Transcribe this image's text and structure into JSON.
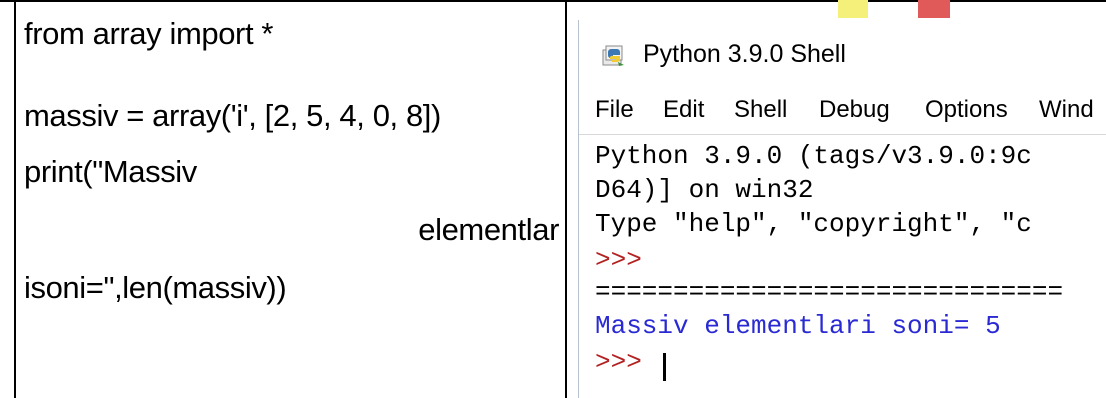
{
  "code_cell": {
    "line1": "from array import *",
    "line2": "massiv = array('i', [2, 5, 4, 0, 8])",
    "line3": "print(\"Massiv",
    "line4": "elementlar",
    "line5": "isoni=\",len(massiv))"
  },
  "shell": {
    "title": "Python 3.9.0 Shell",
    "menu": [
      "File",
      "Edit",
      "Shell",
      "Debug",
      "Options",
      "Wind"
    ],
    "console_lines": [
      "Python 3.9.0 (tags/v3.9.0:9c",
      "D64)] on win32",
      "Type \"help\", \"copyright\", \"c",
      ">>>",
      "==============================",
      "Massiv elementlari soni= 5",
      ">>> "
    ]
  },
  "colors": {
    "prompt": "#b22222",
    "output": "#2a2ad4",
    "text": "#000000"
  },
  "icons": {
    "title": "python-shell-icon"
  }
}
